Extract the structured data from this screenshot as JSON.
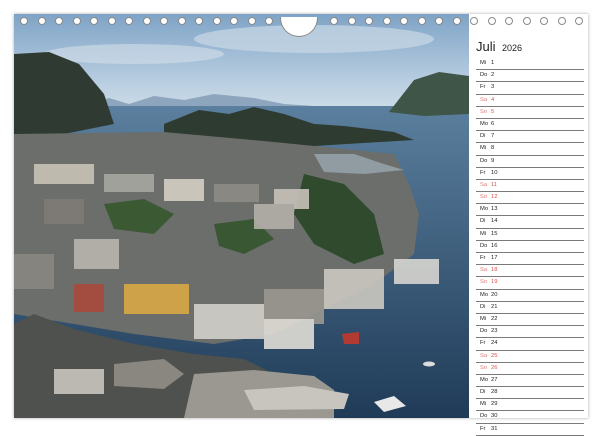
{
  "calendar": {
    "month": "Juli",
    "year": "2026",
    "days": [
      {
        "wd": "Mi",
        "num": "1",
        "weekend": false
      },
      {
        "wd": "Do",
        "num": "2",
        "weekend": false
      },
      {
        "wd": "Fr",
        "num": "3",
        "weekend": false
      },
      {
        "wd": "Sa",
        "num": "4",
        "weekend": true
      },
      {
        "wd": "So",
        "num": "5",
        "weekend": true
      },
      {
        "wd": "Mo",
        "num": "6",
        "weekend": false
      },
      {
        "wd": "Di",
        "num": "7",
        "weekend": false
      },
      {
        "wd": "Mi",
        "num": "8",
        "weekend": false
      },
      {
        "wd": "Do",
        "num": "9",
        "weekend": false
      },
      {
        "wd": "Fr",
        "num": "10",
        "weekend": false
      },
      {
        "wd": "Sa",
        "num": "11",
        "weekend": true
      },
      {
        "wd": "So",
        "num": "12",
        "weekend": true
      },
      {
        "wd": "Mo",
        "num": "13",
        "weekend": false
      },
      {
        "wd": "Di",
        "num": "14",
        "weekend": false
      },
      {
        "wd": "Mi",
        "num": "15",
        "weekend": false
      },
      {
        "wd": "Do",
        "num": "16",
        "weekend": false
      },
      {
        "wd": "Fr",
        "num": "17",
        "weekend": false
      },
      {
        "wd": "Sa",
        "num": "18",
        "weekend": true
      },
      {
        "wd": "So",
        "num": "19",
        "weekend": true
      },
      {
        "wd": "Mo",
        "num": "20",
        "weekend": false
      },
      {
        "wd": "Di",
        "num": "21",
        "weekend": false
      },
      {
        "wd": "Mi",
        "num": "22",
        "weekend": false
      },
      {
        "wd": "Do",
        "num": "23",
        "weekend": false
      },
      {
        "wd": "Fr",
        "num": "24",
        "weekend": false
      },
      {
        "wd": "Sa",
        "num": "25",
        "weekend": true
      },
      {
        "wd": "So",
        "num": "26",
        "weekend": true
      },
      {
        "wd": "Mo",
        "num": "27",
        "weekend": false
      },
      {
        "wd": "Di",
        "num": "28",
        "weekend": false
      },
      {
        "wd": "Mi",
        "num": "29",
        "weekend": false
      },
      {
        "wd": "Do",
        "num": "30",
        "weekend": false
      },
      {
        "wd": "Fr",
        "num": "31",
        "weekend": false
      }
    ]
  },
  "colors": {
    "weekend_text": "#d9534f",
    "line": "#7a7a7a",
    "sea": "#2c4d6e",
    "sky": "#a9c4dc"
  }
}
